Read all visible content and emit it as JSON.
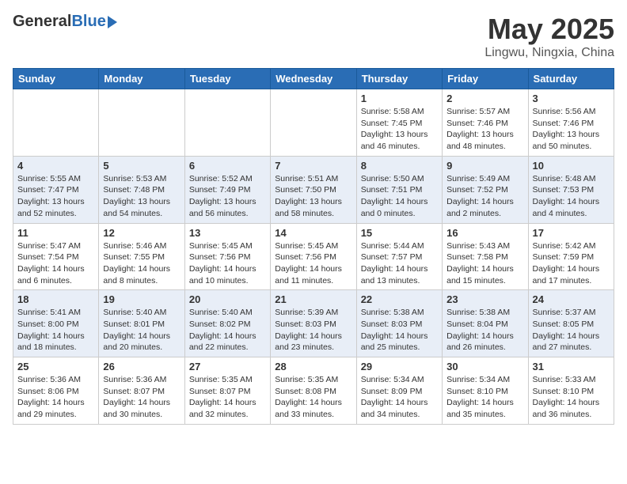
{
  "header": {
    "logo_general": "General",
    "logo_blue": "Blue",
    "month": "May 2025",
    "location": "Lingwu, Ningxia, China"
  },
  "weekdays": [
    "Sunday",
    "Monday",
    "Tuesday",
    "Wednesday",
    "Thursday",
    "Friday",
    "Saturday"
  ],
  "weeks": [
    [
      {
        "day": "",
        "content": ""
      },
      {
        "day": "",
        "content": ""
      },
      {
        "day": "",
        "content": ""
      },
      {
        "day": "",
        "content": ""
      },
      {
        "day": "1",
        "content": "Sunrise: 5:58 AM\nSunset: 7:45 PM\nDaylight: 13 hours\nand 46 minutes."
      },
      {
        "day": "2",
        "content": "Sunrise: 5:57 AM\nSunset: 7:46 PM\nDaylight: 13 hours\nand 48 minutes."
      },
      {
        "day": "3",
        "content": "Sunrise: 5:56 AM\nSunset: 7:46 PM\nDaylight: 13 hours\nand 50 minutes."
      }
    ],
    [
      {
        "day": "4",
        "content": "Sunrise: 5:55 AM\nSunset: 7:47 PM\nDaylight: 13 hours\nand 52 minutes."
      },
      {
        "day": "5",
        "content": "Sunrise: 5:53 AM\nSunset: 7:48 PM\nDaylight: 13 hours\nand 54 minutes."
      },
      {
        "day": "6",
        "content": "Sunrise: 5:52 AM\nSunset: 7:49 PM\nDaylight: 13 hours\nand 56 minutes."
      },
      {
        "day": "7",
        "content": "Sunrise: 5:51 AM\nSunset: 7:50 PM\nDaylight: 13 hours\nand 58 minutes."
      },
      {
        "day": "8",
        "content": "Sunrise: 5:50 AM\nSunset: 7:51 PM\nDaylight: 14 hours\nand 0 minutes."
      },
      {
        "day": "9",
        "content": "Sunrise: 5:49 AM\nSunset: 7:52 PM\nDaylight: 14 hours\nand 2 minutes."
      },
      {
        "day": "10",
        "content": "Sunrise: 5:48 AM\nSunset: 7:53 PM\nDaylight: 14 hours\nand 4 minutes."
      }
    ],
    [
      {
        "day": "11",
        "content": "Sunrise: 5:47 AM\nSunset: 7:54 PM\nDaylight: 14 hours\nand 6 minutes."
      },
      {
        "day": "12",
        "content": "Sunrise: 5:46 AM\nSunset: 7:55 PM\nDaylight: 14 hours\nand 8 minutes."
      },
      {
        "day": "13",
        "content": "Sunrise: 5:45 AM\nSunset: 7:56 PM\nDaylight: 14 hours\nand 10 minutes."
      },
      {
        "day": "14",
        "content": "Sunrise: 5:45 AM\nSunset: 7:56 PM\nDaylight: 14 hours\nand 11 minutes."
      },
      {
        "day": "15",
        "content": "Sunrise: 5:44 AM\nSunset: 7:57 PM\nDaylight: 14 hours\nand 13 minutes."
      },
      {
        "day": "16",
        "content": "Sunrise: 5:43 AM\nSunset: 7:58 PM\nDaylight: 14 hours\nand 15 minutes."
      },
      {
        "day": "17",
        "content": "Sunrise: 5:42 AM\nSunset: 7:59 PM\nDaylight: 14 hours\nand 17 minutes."
      }
    ],
    [
      {
        "day": "18",
        "content": "Sunrise: 5:41 AM\nSunset: 8:00 PM\nDaylight: 14 hours\nand 18 minutes."
      },
      {
        "day": "19",
        "content": "Sunrise: 5:40 AM\nSunset: 8:01 PM\nDaylight: 14 hours\nand 20 minutes."
      },
      {
        "day": "20",
        "content": "Sunrise: 5:40 AM\nSunset: 8:02 PM\nDaylight: 14 hours\nand 22 minutes."
      },
      {
        "day": "21",
        "content": "Sunrise: 5:39 AM\nSunset: 8:03 PM\nDaylight: 14 hours\nand 23 minutes."
      },
      {
        "day": "22",
        "content": "Sunrise: 5:38 AM\nSunset: 8:03 PM\nDaylight: 14 hours\nand 25 minutes."
      },
      {
        "day": "23",
        "content": "Sunrise: 5:38 AM\nSunset: 8:04 PM\nDaylight: 14 hours\nand 26 minutes."
      },
      {
        "day": "24",
        "content": "Sunrise: 5:37 AM\nSunset: 8:05 PM\nDaylight: 14 hours\nand 27 minutes."
      }
    ],
    [
      {
        "day": "25",
        "content": "Sunrise: 5:36 AM\nSunset: 8:06 PM\nDaylight: 14 hours\nand 29 minutes."
      },
      {
        "day": "26",
        "content": "Sunrise: 5:36 AM\nSunset: 8:07 PM\nDaylight: 14 hours\nand 30 minutes."
      },
      {
        "day": "27",
        "content": "Sunrise: 5:35 AM\nSunset: 8:07 PM\nDaylight: 14 hours\nand 32 minutes."
      },
      {
        "day": "28",
        "content": "Sunrise: 5:35 AM\nSunset: 8:08 PM\nDaylight: 14 hours\nand 33 minutes."
      },
      {
        "day": "29",
        "content": "Sunrise: 5:34 AM\nSunset: 8:09 PM\nDaylight: 14 hours\nand 34 minutes."
      },
      {
        "day": "30",
        "content": "Sunrise: 5:34 AM\nSunset: 8:10 PM\nDaylight: 14 hours\nand 35 minutes."
      },
      {
        "day": "31",
        "content": "Sunrise: 5:33 AM\nSunset: 8:10 PM\nDaylight: 14 hours\nand 36 minutes."
      }
    ]
  ]
}
